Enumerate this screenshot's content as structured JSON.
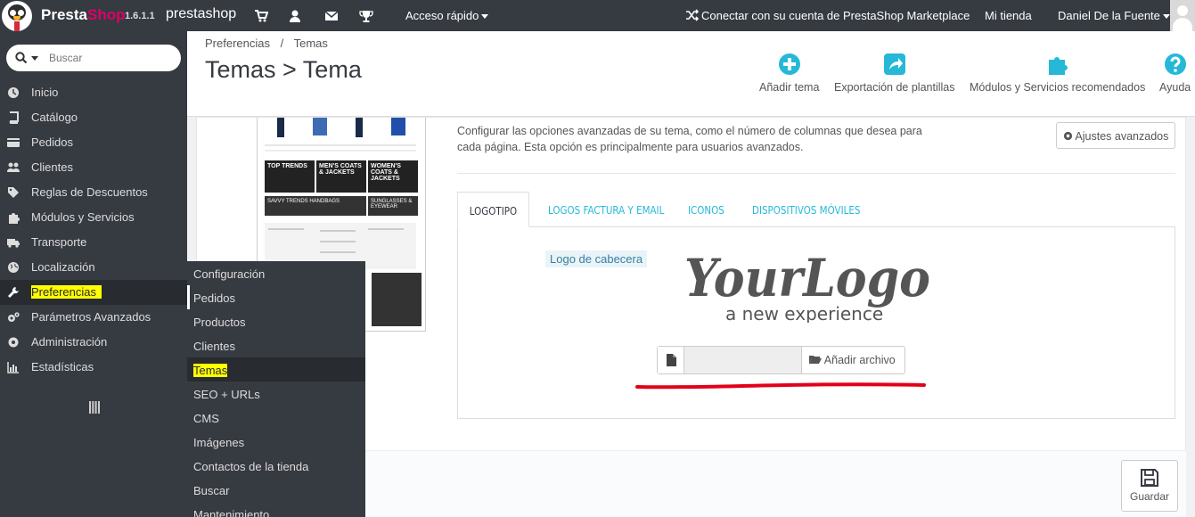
{
  "topbar": {
    "brand_presta": "Presta",
    "brand_shop": "Shop",
    "version": "1.6.1.1",
    "shop_name": "prestashop",
    "quick_access": "Acceso rápido",
    "marketplace": "Conectar con su cuenta de PrestaShop Marketplace",
    "my_store": "Mi tienda",
    "user": "Daniel De la Fuente"
  },
  "search": {
    "placeholder": "Buscar"
  },
  "sidebar": {
    "items": [
      {
        "label": "Inicio",
        "icon": "home-icon"
      },
      {
        "label": "Catálogo",
        "icon": "book-icon"
      },
      {
        "label": "Pedidos",
        "icon": "credit-card-icon"
      },
      {
        "label": "Clientes",
        "icon": "users-icon"
      },
      {
        "label": "Reglas de Descuentos",
        "icon": "tags-icon"
      },
      {
        "label": "Módulos y Servicios",
        "icon": "puzzle-icon"
      },
      {
        "label": "Transporte",
        "icon": "truck-icon"
      },
      {
        "label": "Localización",
        "icon": "globe-icon"
      },
      {
        "label": "Preferencias",
        "icon": "wrench-icon"
      },
      {
        "label": "Parámetros Avanzados",
        "icon": "cogs-icon"
      },
      {
        "label": "Administración",
        "icon": "cog-icon"
      },
      {
        "label": "Estadísticas",
        "icon": "bar-chart-icon"
      }
    ]
  },
  "submenu": {
    "items": [
      "Configuración",
      "Pedidos",
      "Productos",
      "Clientes",
      "Temas",
      "SEO + URLs",
      "CMS",
      "Imágenes",
      "Contactos de la tienda",
      "Buscar",
      "Mantenimiento"
    ]
  },
  "header": {
    "breadcrumb_parent": "Preferencias",
    "breadcrumb_sep": "/",
    "breadcrumb_current": "Temas",
    "title": "Temas > Tema",
    "toolbar": {
      "add_theme": "Añadir tema",
      "export": "Exportación de plantillas",
      "modules": "Módulos y Servicios recomendados",
      "help": "Ayuda"
    }
  },
  "main": {
    "description": "Configurar las opciones avanzadas de su tema, como el número de columnas que desea para cada página. Esta opción es principalmente para usuarios avanzados.",
    "advanced_settings": "Ajustes avanzados",
    "tabs": [
      "LOGOTIPO",
      "LOGOS FACTURA Y EMAIL",
      "ICONOS",
      "DISPOSITIVOS MÓVILES"
    ],
    "logo_label": "Logo de cabecera",
    "logo_text": "YourLogo",
    "logo_tagline": "a new experience",
    "add_file": "Añadir archivo",
    "save": "Guardar"
  },
  "thumbnail": {
    "banners": [
      "TOP TRENDS",
      "MEN'S COATS & JACKETS",
      "WOMEN'S COATS & JACKETS",
      "SAVVY TRENDS HANDBAGS",
      "SUNGLASSES & EYEWEAR"
    ]
  },
  "colors": {
    "topbar": "#363a41",
    "brand_pink": "#df0067",
    "accent_blue": "#25b9d7",
    "highlight": "#ffff00",
    "annotation_red": "#e2001a"
  }
}
